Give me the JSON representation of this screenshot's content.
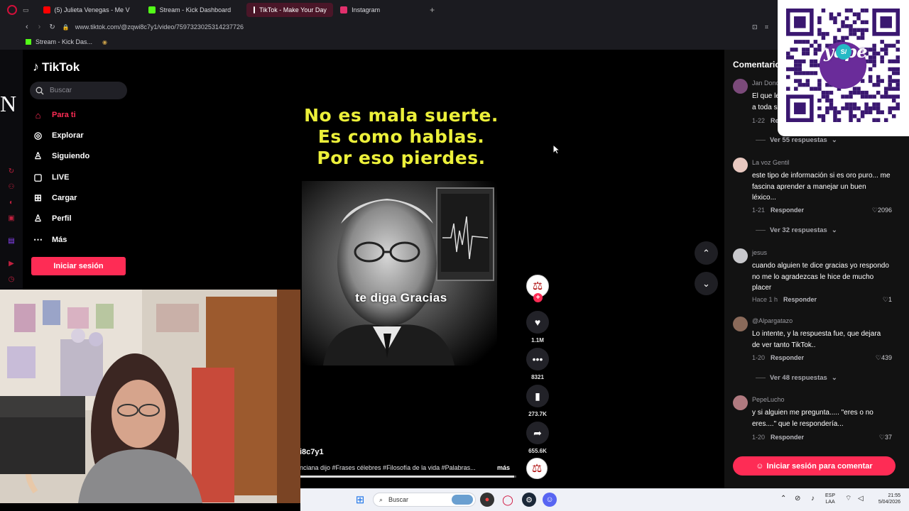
{
  "browser": {
    "tabs": [
      {
        "label": "(5) Julieta Venegas - Me V",
        "color": "#ff0000"
      },
      {
        "label": "Stream - Kick Dashboard",
        "color": "#53fc18"
      },
      {
        "label": "TikTok - Make Your Day",
        "color": "#ffffff"
      },
      {
        "label": "Instagram",
        "color": "#e1306c"
      }
    ],
    "url": "www.tiktok.com/@zqwi8c7y1/video/7597323025314237726",
    "bookmark": "Stream - Kick Das..."
  },
  "tiktok": {
    "logo": "TikTok",
    "search_placeholder": "Buscar",
    "nav": [
      {
        "label": "Para ti",
        "icon": "home-icon"
      },
      {
        "label": "Explorar",
        "icon": "compass-icon"
      },
      {
        "label": "Siguiendo",
        "icon": "following-icon"
      },
      {
        "label": "LIVE",
        "icon": "live-icon"
      },
      {
        "label": "Cargar",
        "icon": "upload-icon"
      },
      {
        "label": "Perfil",
        "icon": "profile-icon"
      },
      {
        "label": "Más",
        "icon": "more-icon"
      }
    ],
    "login_button": "Iniciar sesión"
  },
  "video": {
    "overlay_lines": [
      "No es mala suerte.",
      "Es como hablas.",
      "Por eso pierdes."
    ],
    "subtitle": "te diga Gracias",
    "author": "i8c7y1",
    "caption": "nciana dijo #Frases célebres #Filosofía de la vida #Palabras...",
    "caption_more": "más",
    "progress": 0.99
  },
  "actions": {
    "likes": "1.1M",
    "comments": "8321",
    "saves": "273.7K",
    "shares": "655.6K"
  },
  "comments": {
    "title": "Comentario",
    "reply_label": "Responder",
    "items": [
      {
        "user": "Jan Dono",
        "text": "El que le",
        "text2": "a toda s",
        "time": "1-22",
        "reply": "Re",
        "likes": "",
        "replies": "Ver 55 respuestas",
        "avatar_color": "#7b4a7a"
      },
      {
        "user": "La voz Gentil",
        "text": "este tipo de información si es oro puro... me fascina aprender a manejar un buen léxico...",
        "time": "1-21",
        "likes": "2096",
        "replies": "Ver 32 respuestas",
        "avatar_color": "#e8c8c0"
      },
      {
        "user": "jesus",
        "text": "cuando alguien te dice gracias yo respondo no me lo agradezcas le hice de mucho placer",
        "time": "Hace 1 h",
        "likes": "1",
        "replies": "",
        "avatar_color": "#c8c8cc"
      },
      {
        "user": "@Alpargatazo",
        "text": "Lo intente, y la respuesta fue, que dejara de ver tanto TikTok..",
        "time": "1-20",
        "likes": "439",
        "replies": "Ver 48 respuestas",
        "avatar_color": "#8a6a5a"
      },
      {
        "user": "PepeLucho",
        "text": "y si alguien me pregunta..... \"eres o no eres....\" que le respondería...",
        "time": "1-20",
        "likes": "37",
        "replies": "",
        "avatar_color": "#b07a80"
      }
    ],
    "login_button": "Iniciar sesión para comentar"
  },
  "qr": {
    "brand": "yape",
    "badge": "S/"
  },
  "taskbar": {
    "search_placeholder": "Buscar",
    "lang_top": "ESP",
    "lang_bottom": "LAA",
    "time": "21:55",
    "date": "5/04/2026"
  },
  "side_glyph": "N"
}
